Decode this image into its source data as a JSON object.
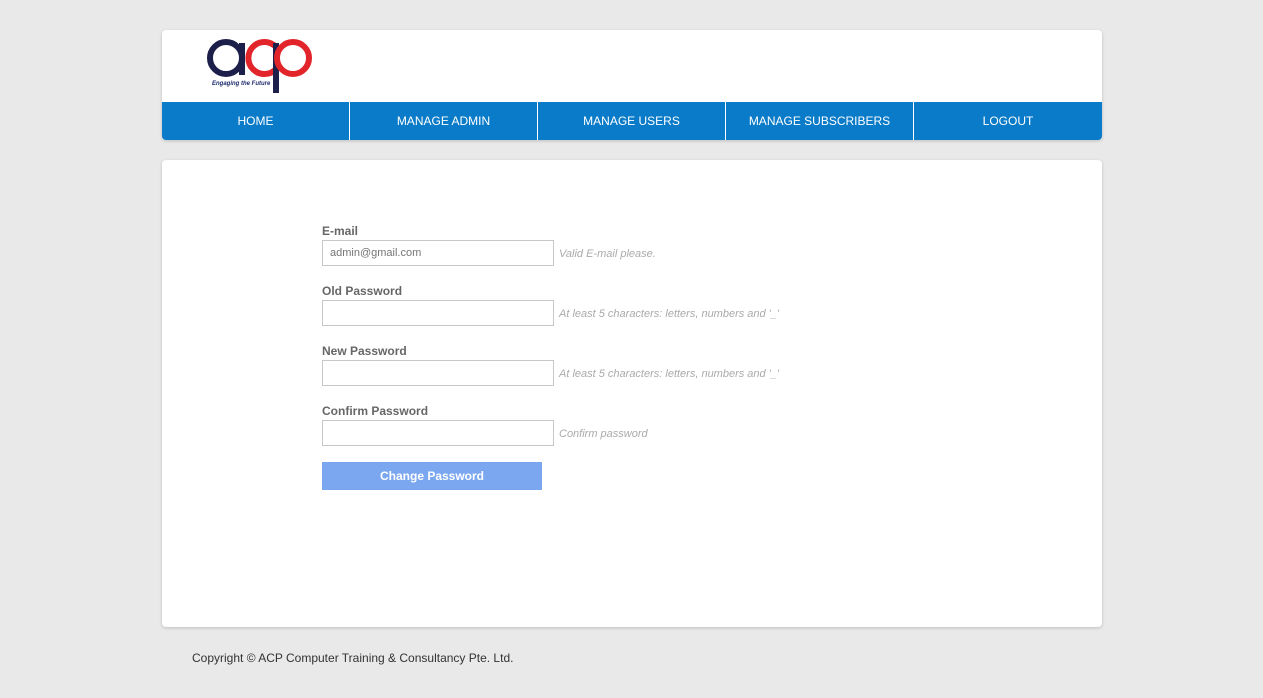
{
  "logo": {
    "brand_text": "acp",
    "tagline": "Engaging the Future",
    "icon": "acp-logo",
    "colors": {
      "dark": "#1c1f4a",
      "red": "#e2242b"
    }
  },
  "nav": {
    "items": [
      {
        "label": "HOME"
      },
      {
        "label": "MANAGE ADMIN"
      },
      {
        "label": "MANAGE USERS"
      },
      {
        "label": "MANAGE SUBSCRIBERS"
      },
      {
        "label": "LOGOUT"
      }
    ],
    "background": "#0a7bc8"
  },
  "form": {
    "email": {
      "label": "E-mail",
      "placeholder": "admin@gmail.com",
      "hint": "Valid E-mail please."
    },
    "old_password": {
      "label": "Old Password",
      "value": "",
      "hint": "At least 5 characters: letters, numbers and '_'"
    },
    "new_password": {
      "label": "New Password",
      "value": "",
      "hint": "At least 5 characters: letters, numbers and '_'"
    },
    "confirm_password": {
      "label": "Confirm Password",
      "value": "",
      "hint": "Confirm password"
    },
    "submit_label": "Change Password",
    "submit_color": "#7aa7f0"
  },
  "footer": {
    "copyright": "Copyright © ACP Computer Training & Consultancy Pte. Ltd."
  }
}
